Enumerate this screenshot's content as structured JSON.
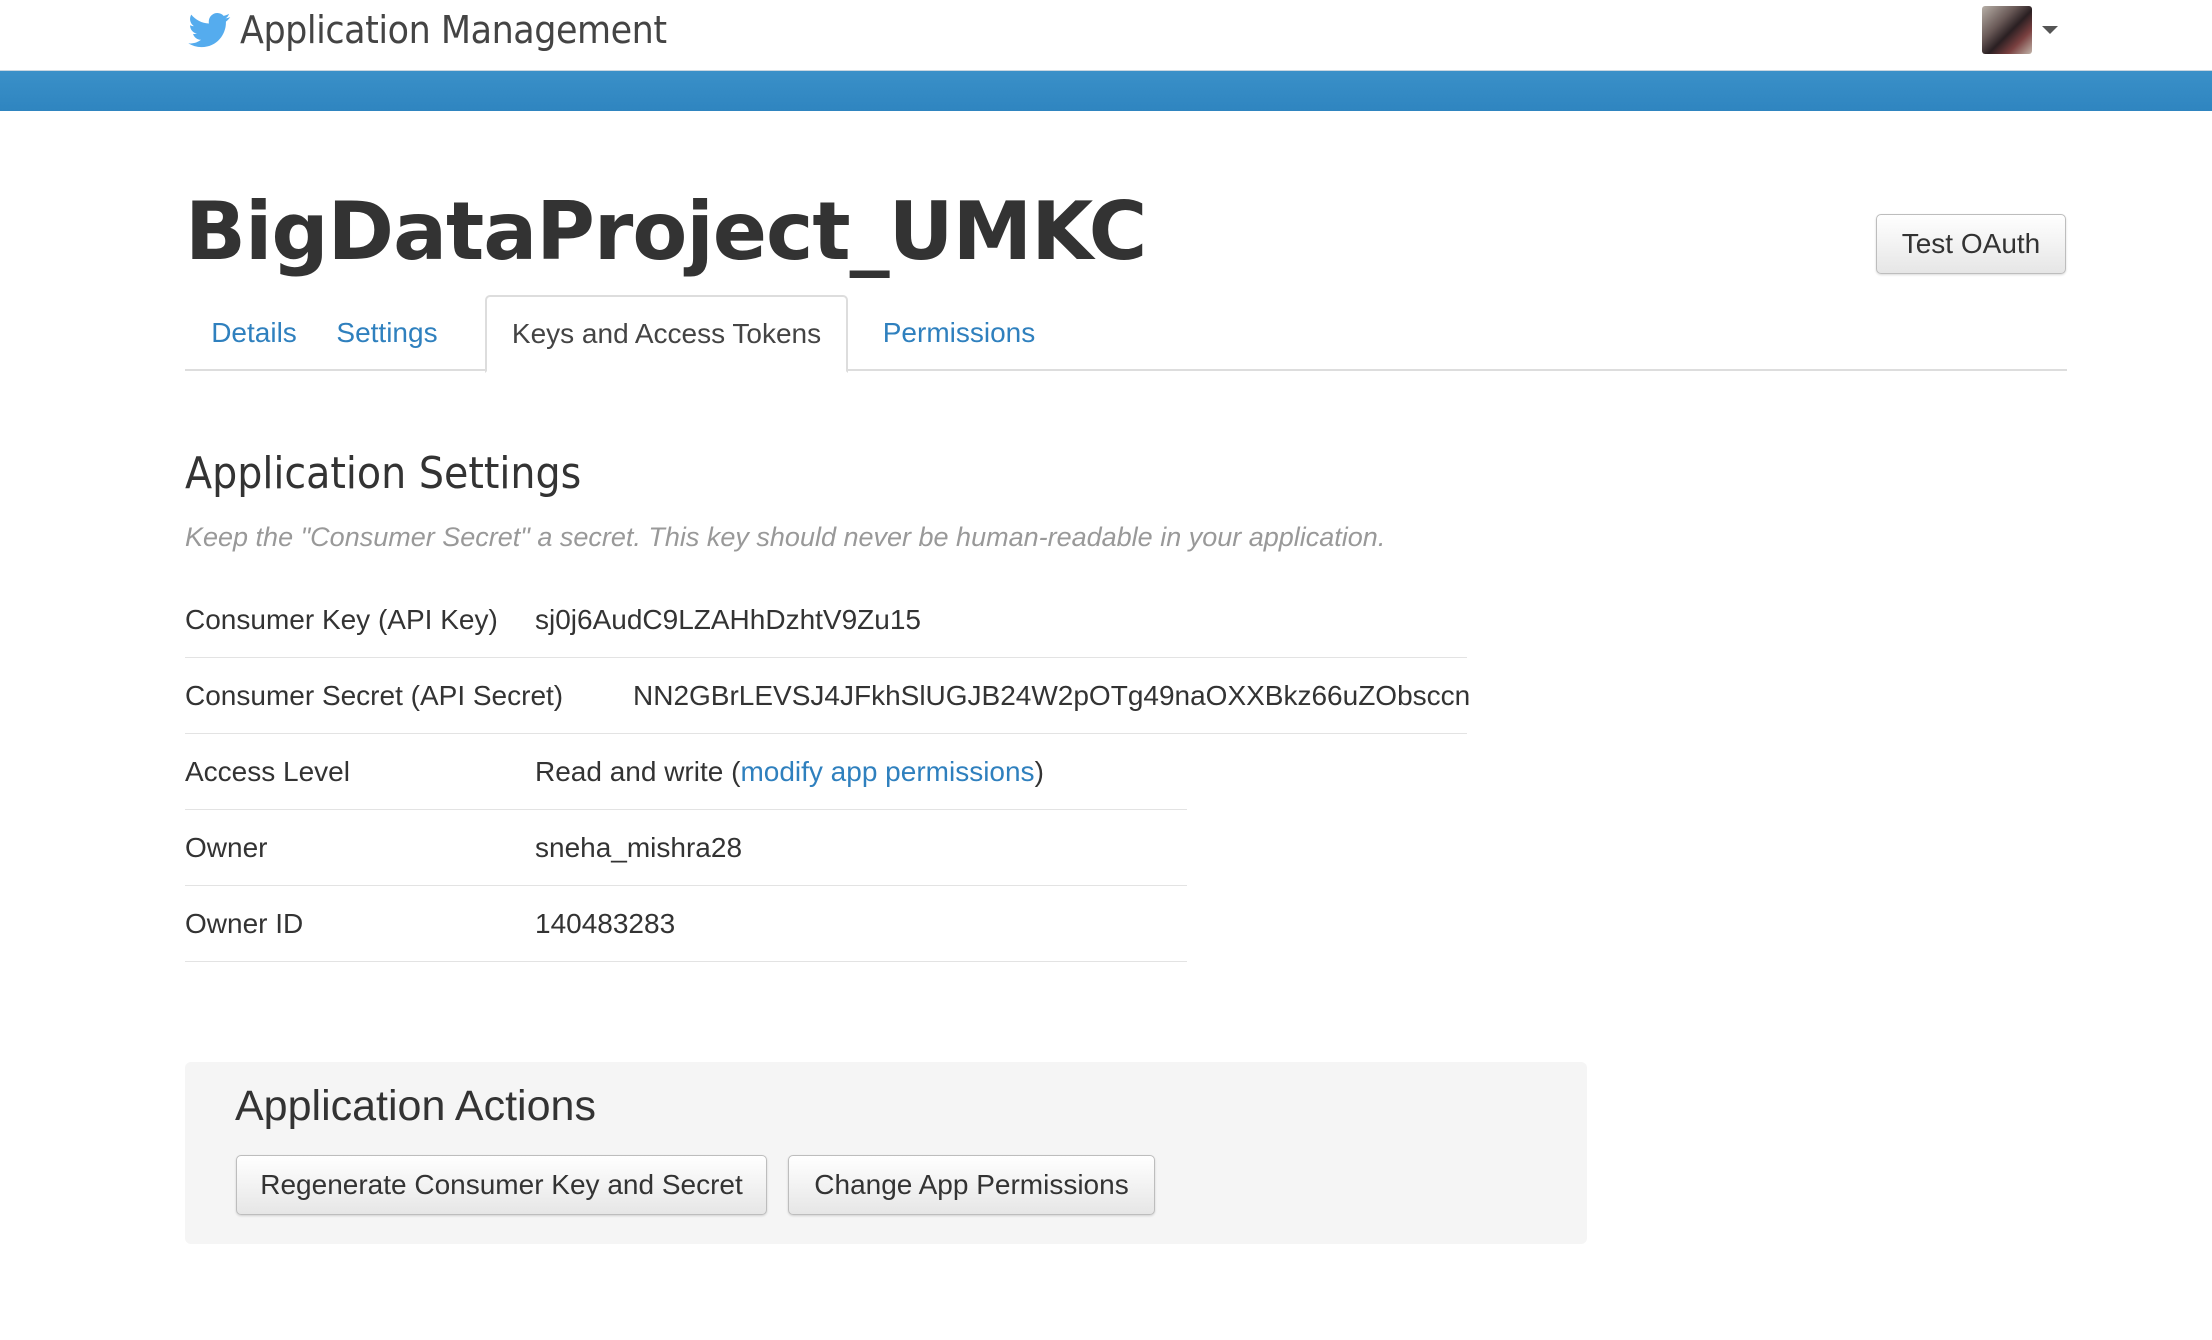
{
  "header": {
    "brand_title": "Application Management",
    "brand_icon": "twitter-bird-icon",
    "accent_color": "#2f85c0"
  },
  "app": {
    "name": "BigDataProject_UMKC",
    "test_oauth_label": "Test OAuth"
  },
  "tabs": [
    {
      "label": "Details",
      "active": false
    },
    {
      "label": "Settings",
      "active": false
    },
    {
      "label": "Keys and Access Tokens",
      "active": true
    },
    {
      "label": "Permissions",
      "active": false
    }
  ],
  "settings": {
    "title": "Application Settings",
    "hint": "Keep the \"Consumer Secret\" a secret. This key should never be human-readable in your application.",
    "rows": [
      {
        "label": "Consumer Key (API Key)",
        "value": "sj0j6AudC9LZAHhDzhtV9Zu15"
      },
      {
        "label": "Consumer Secret (API Secret)",
        "value": "NN2GBrLEVSJ4JFkhSlUGJB24W2pOTg49naOXXBkz66uZObsccn"
      },
      {
        "label": "Access Level",
        "value_prefix": "Read and write (",
        "link": "modify app permissions",
        "value_suffix": ")"
      },
      {
        "label": "Owner",
        "value": "sneha_mishra28"
      },
      {
        "label": "Owner ID",
        "value": "140483283"
      }
    ]
  },
  "actions": {
    "title": "Application Actions",
    "regenerate_label": "Regenerate Consumer Key and Secret",
    "change_permissions_label": "Change App Permissions"
  }
}
